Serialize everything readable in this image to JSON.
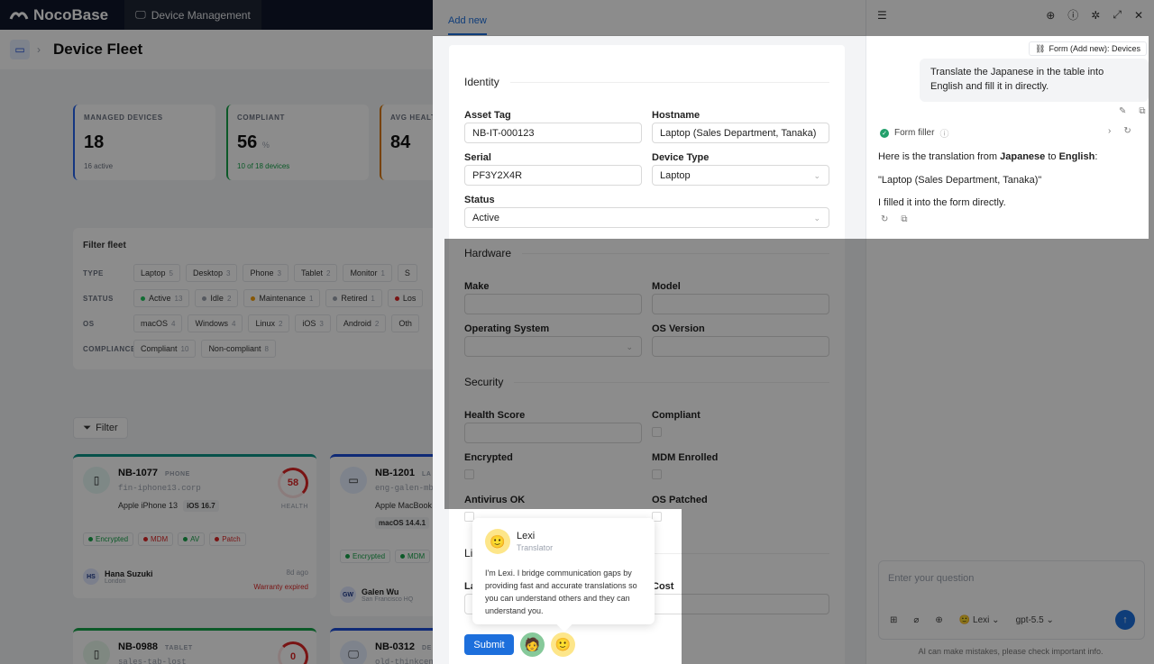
{
  "app": {
    "logo_text": "NocoBase",
    "nav_item": "Device Management",
    "page_title": "Device Fleet"
  },
  "kpis": [
    {
      "label": "MANAGED DEVICES",
      "value": "18",
      "unit": "",
      "sub": "16 active",
      "accent": "#2563eb"
    },
    {
      "label": "COMPLIANT",
      "value": "56",
      "unit": "%",
      "sub": "10 of 18 devices",
      "accent": "#16a34a"
    },
    {
      "label": "AVG HEALT",
      "value": "84",
      "unit": "",
      "sub": "",
      "accent": "#d97706"
    }
  ],
  "filter": {
    "title": "Filter fleet",
    "rows": [
      {
        "key": "TYPE",
        "chips": [
          {
            "label": "Laptop",
            "count": "5"
          },
          {
            "label": "Desktop",
            "count": "3"
          },
          {
            "label": "Phone",
            "count": "3"
          },
          {
            "label": "Tablet",
            "count": "2"
          },
          {
            "label": "Monitor",
            "count": "1"
          },
          {
            "label": "S",
            "count": ""
          }
        ]
      },
      {
        "key": "STATUS",
        "chips": [
          {
            "label": "Active",
            "count": "13",
            "dot": "#22c55e"
          },
          {
            "label": "Idle",
            "count": "2",
            "dot": "#9ca3af"
          },
          {
            "label": "Maintenance",
            "count": "1",
            "dot": "#f59e0b"
          },
          {
            "label": "Retired",
            "count": "1",
            "dot": "#9ca3af"
          },
          {
            "label": "Los",
            "count": "",
            "dot": "#dc2626"
          }
        ]
      },
      {
        "key": "OS",
        "chips": [
          {
            "label": "macOS",
            "count": "4"
          },
          {
            "label": "Windows",
            "count": "4"
          },
          {
            "label": "Linux",
            "count": "2"
          },
          {
            "label": "iOS",
            "count": "3"
          },
          {
            "label": "Android",
            "count": "2"
          },
          {
            "label": "Oth",
            "count": ""
          }
        ]
      },
      {
        "key": "COMPLIANCE",
        "chips": [
          {
            "label": "Compliant",
            "count": "10"
          },
          {
            "label": "Non-compliant",
            "count": "8"
          }
        ]
      }
    ],
    "button": "Filter"
  },
  "cards": [
    {
      "name": "NB-1077",
      "type": "PHONE",
      "host": "fin-iphone13.corp",
      "model": "Apple iPhone 13",
      "os": "iOS 16.7",
      "health": "58",
      "health_label": "HEALTH",
      "badges": [
        "Encrypted",
        "MDM",
        "AV",
        "Patch"
      ],
      "user_initials": "HS",
      "user": "Hana Suzuki",
      "location": "London",
      "ago": "8d ago",
      "warranty": "Warranty expired"
    },
    {
      "name": "NB-1201",
      "type": "LA",
      "host": "eng-galen-mbp",
      "model": "Apple MacBook",
      "os": "macOS 14.4.1",
      "badges": [
        "Encrypted",
        "MDM"
      ],
      "user_initials": "GW",
      "user": "Galen Wu",
      "location": "San Francisco HQ"
    },
    {
      "name": "NB-0988",
      "type": "TABLET",
      "host": "sales-tab-lost",
      "health": "0"
    },
    {
      "name": "NB-0312",
      "type": "DE",
      "host": "old-thinkcen"
    }
  ],
  "drawer": {
    "tab": "Add new",
    "sections": {
      "identity": "Identity",
      "hardware": "Hardware",
      "security": "Security",
      "lifecycle": "Li"
    },
    "fields": {
      "asset_tag": {
        "label": "Asset Tag",
        "value": "NB-IT-000123"
      },
      "hostname": {
        "label": "Hostname",
        "value": "Laptop (Sales Department, Tanaka)"
      },
      "serial": {
        "label": "Serial",
        "value": "PF3Y2X4R"
      },
      "device_type": {
        "label": "Device Type",
        "value": "Laptop"
      },
      "status": {
        "label": "Status",
        "value": "Active"
      },
      "make": {
        "label": "Make",
        "value": ""
      },
      "model": {
        "label": "Model",
        "value": ""
      },
      "operating_system": {
        "label": "Operating System",
        "value": ""
      },
      "os_version": {
        "label": "OS Version",
        "value": ""
      },
      "health_score": {
        "label": "Health Score",
        "value": ""
      },
      "compliant": {
        "label": "Compliant"
      },
      "encrypted": {
        "label": "Encrypted"
      },
      "mdm_enrolled": {
        "label": "MDM Enrolled"
      },
      "antivirus_ok": {
        "label": "Antivirus OK"
      },
      "os_patched": {
        "label": "OS Patched"
      },
      "la_label": {
        "label": "La"
      },
      "cost": {
        "label": "Cost"
      }
    },
    "submit": "Submit"
  },
  "popover": {
    "name": "Lexi",
    "role": "Translator",
    "description": "I'm Lexi. I bridge communication gaps by providing fast and accurate translations so you can understand others and they can understand you."
  },
  "ai_panel": {
    "context_tag": "Form (Add new): Devices",
    "user_message": "Translate the Japanese in the table into English and fill it in directly.",
    "tool_name": "Form filler",
    "response_prefix": "Here is the translation from ",
    "response_from": "Japanese",
    "response_mid": " to ",
    "response_to": "English",
    "response_colon": ":",
    "quoted": "\"Laptop (Sales Department, Tanaka)\"",
    "filled": "I filled it into the form directly.",
    "input_placeholder": "Enter your question",
    "agent": "Lexi",
    "model": "gpt-5.5",
    "disclaimer": "AI can make mistakes, please check important info."
  },
  "colors": {
    "primary": "#1d6fdc",
    "danger": "#dc2626",
    "success": "#22a06b"
  }
}
